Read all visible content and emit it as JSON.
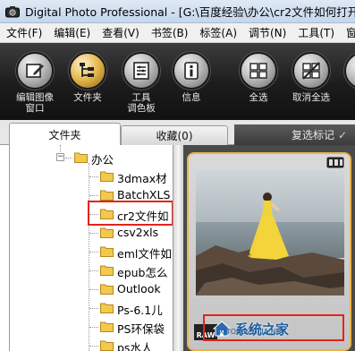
{
  "window": {
    "title": "Digital Photo Professional - [G:\\百度经验\\办公\\cr2文件如何打开]"
  },
  "menu": [
    {
      "label": "文件(F)"
    },
    {
      "label": "编辑(E)"
    },
    {
      "label": "查看(V)"
    },
    {
      "label": "书签(B)"
    },
    {
      "label": "标签(A)"
    },
    {
      "label": "调节(N)"
    },
    {
      "label": "工具(T)"
    },
    {
      "label": "窗"
    }
  ],
  "toolbar": {
    "edit_image": {
      "line1": "编辑图像",
      "line2": "窗口"
    },
    "folder": {
      "line1": "文件夹"
    },
    "tool_palette": {
      "line1": "工具",
      "line2": "调色板"
    },
    "info": {
      "line1": "信息"
    },
    "select_all": {
      "line1": "全选"
    },
    "deselect_all": {
      "line1": "取消全选"
    },
    "partial": {
      "line1": "左"
    }
  },
  "panel": {
    "tab_folder": "文件夹",
    "tab_favorites": "收藏(0)",
    "duplicate_mark": "复选标记"
  },
  "tree": {
    "parent": "办公",
    "items": [
      "3dmax材",
      "BatchXLS",
      "cr2文件如",
      "csv2xls",
      "eml文件如",
      "epub怎么",
      "Outlook",
      "Ps-6.1儿",
      "PS环保袋",
      "ps水人"
    ],
    "selected_index": 2
  },
  "thumbnail": {
    "badge": "RAW",
    "watermark": "系统之家",
    "watermark_sub": "XITONGZHIJIA.NET"
  },
  "colors": {
    "highlight": "#e3231b",
    "folder_yellow": "#f2c94c",
    "selection_border": "#e9b44c"
  }
}
